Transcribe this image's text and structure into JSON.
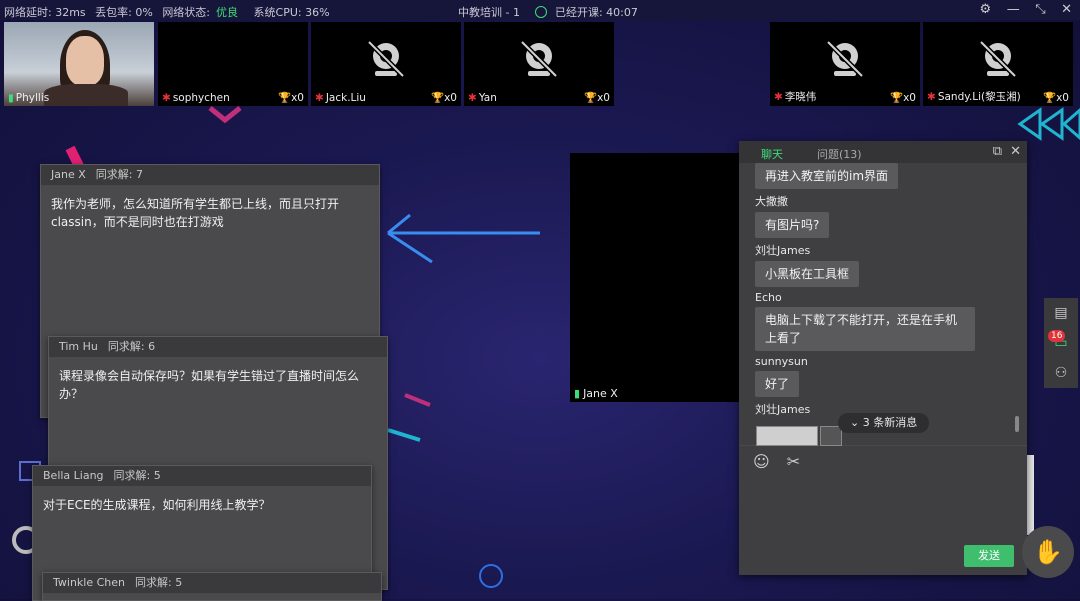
{
  "topbar": {
    "latency_label": "网络延时: 32ms",
    "loss_label": "丢包率: 0%",
    "network_label": "网络状态:",
    "network_value": "优良",
    "cpu_label": "系统CPU: 36%",
    "class_title": "中教培训 - 1",
    "elapsed_label": "已经开课: 40:07"
  },
  "tiles": [
    {
      "name": "Phyllis"
    },
    {
      "name": "sophychen",
      "score": "x0"
    },
    {
      "name": "Jack.Liu",
      "score": "x0"
    },
    {
      "name": "Yan",
      "score": "x0"
    },
    {
      "name": "李晓伟",
      "score": "x0"
    },
    {
      "name": "Sandy.Li(黎玉湘)",
      "score": "x0"
    }
  ],
  "questions": [
    {
      "author": "Jane X",
      "count": "同求解: 7",
      "text": "我作为老师，怎么知道所有学生都已上线，而且只打开classin，而不是同时也在打游戏"
    },
    {
      "author": "Tim Hu",
      "count": "同求解: 6",
      "text": "课程录像会自动保存吗？如果有学生错过了直播时间怎么办？"
    },
    {
      "author": "Bella Liang",
      "count": "同求解: 5",
      "text": "对于ECE的生成课程，如何利用线上教学？"
    },
    {
      "author": "Twinkle Chen",
      "count": "同求解: 5"
    }
  ],
  "video": {
    "name": "Jane X"
  },
  "chat": {
    "tab_chat": "聊天",
    "tab_questions": "问题(13)",
    "messages": [
      {
        "who": "",
        "text": "再进入教室前的im界面"
      },
      {
        "who": "大撒撒",
        "text": "有图片吗?"
      },
      {
        "who": "刘壮James",
        "text": "小黑板在工具框"
      },
      {
        "who": "Echo",
        "text": "电脑上下载了不能打开，还是在手机上看了"
      },
      {
        "who": "sunnysun",
        "text": "好了"
      },
      {
        "who": "刘壮James",
        "text": ""
      }
    ],
    "new_messages": "3 条新消息",
    "send_label": "发送"
  },
  "side_badge": "16"
}
